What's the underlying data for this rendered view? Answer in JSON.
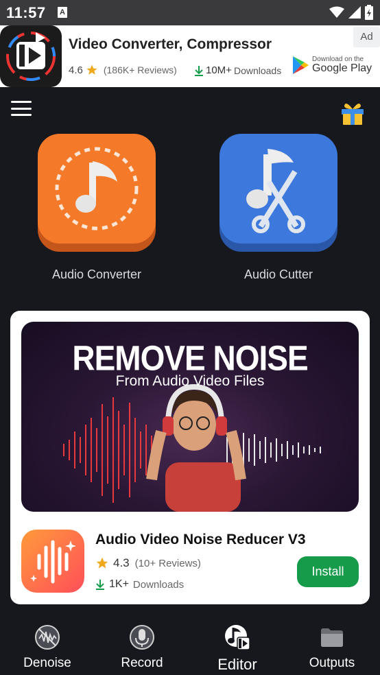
{
  "status_bar": {
    "time": "11:57",
    "notification_letter": "A",
    "icons": [
      "wifi-icon",
      "signal-icon",
      "battery-icon"
    ]
  },
  "top_ad": {
    "app_title": "Video Converter, Compressor",
    "rating": "4.6",
    "reviews": "(186K+ Reviews)",
    "downloads": "10M+",
    "downloads_label": "Downloads",
    "badge": "Ad",
    "store_small": "Download on the",
    "store_name": "Google Play"
  },
  "features": [
    {
      "label": "Audio Converter",
      "icon": "music-note-icon",
      "color": "#f47a2a"
    },
    {
      "label": "Audio Cutter",
      "icon": "scissors-music-icon",
      "color": "#3d78dc"
    }
  ],
  "native_ad": {
    "banner_title": "REMOVE NOISE",
    "banner_subtitle": "From Audio Video Files",
    "app_name": "Audio Video Noise Reducer V3",
    "rating": "4.3",
    "reviews": "(10+ Reviews)",
    "downloads": "1K+",
    "downloads_label": "Downloads",
    "cta": "Install",
    "cta_color": "#169b4a"
  },
  "bottom_nav": {
    "items": [
      {
        "label": "Denoise",
        "icon": "denoise-icon"
      },
      {
        "label": "Record",
        "icon": "microphone-icon"
      },
      {
        "label": "Editor",
        "icon": "editor-icon",
        "active": true
      },
      {
        "label": "Outputs",
        "icon": "folder-icon"
      }
    ]
  }
}
